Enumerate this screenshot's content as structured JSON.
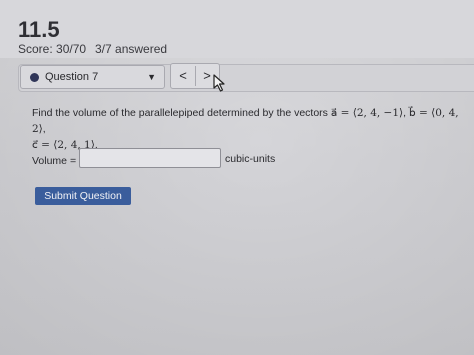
{
  "assignment": {
    "title": "11.5",
    "score": "Score: 30/70",
    "answered": "3/7 answered"
  },
  "navigation": {
    "question_select": "Question 7",
    "prev_label": "<",
    "next_label": ">"
  },
  "question": {
    "prompt_start": "Find the volume of the parallelepiped determined by the vectors ",
    "vec_a": "a⃗ = ⟨2, 4, −1⟩",
    "vec_b": "b⃗ = ⟨0, 4, 2⟩",
    "vec_c": "c⃗ = ⟨2, 4, 1⟩",
    "separator": ", ",
    "end": "."
  },
  "answer": {
    "label": "Volume =",
    "value": "",
    "units": "cubic-units"
  },
  "actions": {
    "submit_label": "Submit Question"
  },
  "colors": {
    "background": "#d7d7db",
    "submit_button": "#3a5d9c",
    "status_dot": "#2f3558"
  },
  "icons": {
    "status": "filled-circle-icon",
    "dropdown": "caret-down-icon",
    "prev": "chevron-left-icon",
    "next": "chevron-right-icon",
    "cursor": "mouse-pointer-icon"
  }
}
